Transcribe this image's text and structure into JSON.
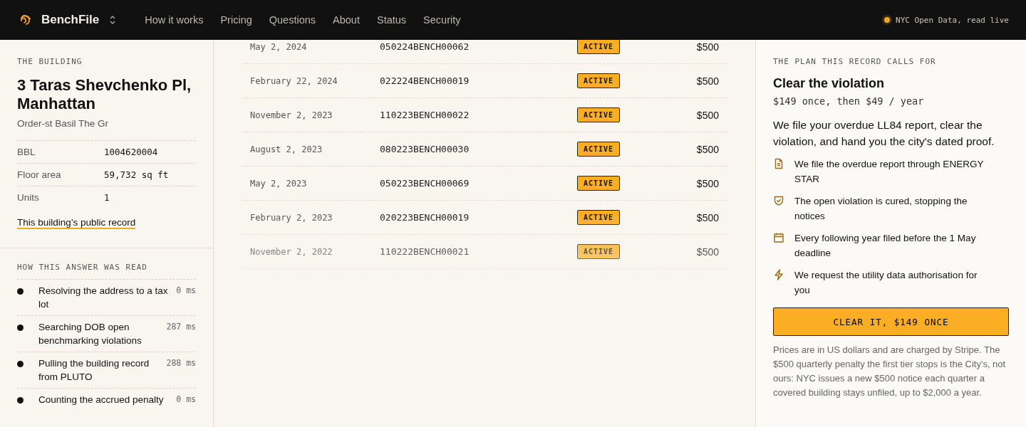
{
  "header": {
    "brand": "BenchFile",
    "nav": [
      "How it works",
      "Pricing",
      "Questions",
      "About",
      "Status",
      "Security"
    ],
    "status": "NYC Open Data, read live"
  },
  "building": {
    "eyebrow": "THE BUILDING",
    "address": "3 Taras Shevchenko Pl, Manhattan",
    "owner": "Order-st Basil The Gr",
    "facts": [
      {
        "label": "BBL",
        "value": "1004620004"
      },
      {
        "label": "Floor area",
        "value": "59,732 sq ft"
      },
      {
        "label": "Units",
        "value": "1"
      }
    ],
    "link": "This building’s public record"
  },
  "steps": {
    "eyebrow": "HOW THIS ANSWER WAS READ",
    "items": [
      {
        "text": "Resolving the address to a tax lot",
        "time": "0 ms"
      },
      {
        "text": "Searching DOB open benchmarking violations",
        "time": "287 ms"
      },
      {
        "text": "Pulling the building record from PLUTO",
        "time": "288 ms"
      },
      {
        "text": "Counting the accrued penalty",
        "time": "0 ms"
      }
    ]
  },
  "violations": [
    {
      "date": "May 2, 2024",
      "number": "050224BENCH00062",
      "status": "ACTIVE",
      "amount": "$500"
    },
    {
      "date": "February 22, 2024",
      "number": "022224BENCH00019",
      "status": "ACTIVE",
      "amount": "$500"
    },
    {
      "date": "November 2, 2023",
      "number": "110223BENCH00022",
      "status": "ACTIVE",
      "amount": "$500"
    },
    {
      "date": "August 2, 2023",
      "number": "080223BENCH00030",
      "status": "ACTIVE",
      "amount": "$500"
    },
    {
      "date": "May 2, 2023",
      "number": "050223BENCH00069",
      "status": "ACTIVE",
      "amount": "$500"
    },
    {
      "date": "February 2, 2023",
      "number": "020223BENCH00019",
      "status": "ACTIVE",
      "amount": "$500"
    },
    {
      "date": "November 2, 2022",
      "number": "110222BENCH00021",
      "status": "ACTIVE",
      "amount": "$500"
    }
  ],
  "plan": {
    "eyebrow": "THE PLAN THIS RECORD CALLS FOR",
    "title": "Clear the violation",
    "price": "$149 once, then $49 / year",
    "summary": "We file your overdue LL84 report, clear the violation, and hand you the city's dated proof.",
    "features": [
      {
        "kind": "document",
        "text": "We file the overdue report through ENERGY STAR"
      },
      {
        "kind": "shield",
        "text": "The open violation is cured, stopping the notices"
      },
      {
        "kind": "calendar",
        "text": "Every following year filed before the 1 May deadline"
      },
      {
        "kind": "bolt",
        "text": "We request the utility data authorisation for you"
      }
    ],
    "button": "CLEAR IT, $149 ONCE",
    "note": "Prices are in US dollars and are charged by Stripe. The $500 quarterly penalty the first tier stops is the City's, not ours: NYC issues a new $500 notice each quarter a covered building stays unfiled, up to $2,000 a year."
  }
}
